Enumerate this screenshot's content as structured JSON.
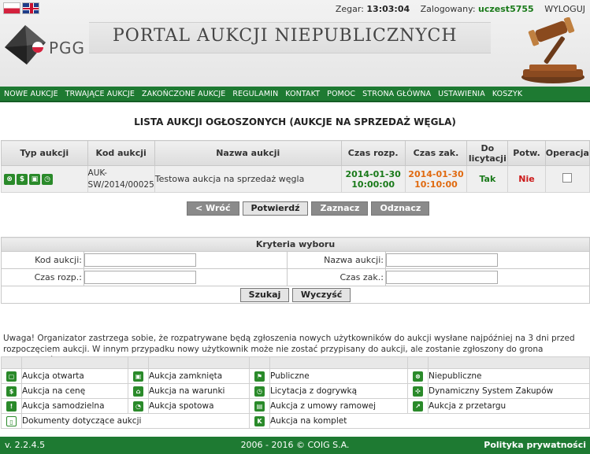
{
  "header": {
    "clock_label": "Zegar:",
    "clock_value": "13:03:04",
    "logged_label": "Zalogowany:",
    "logged_user": "uczest5755",
    "logout": "WYLOGUJ",
    "logo_text": "PGG",
    "banner_title": "PORTAL AUKCJI NIEPUBLICZNYCH"
  },
  "nav": [
    "NOWE AUKCJE",
    "TRWAJĄCE AUKCJE",
    "ZAKOŃCZONE AUKCJE",
    "REGULAMIN",
    "KONTAKT",
    "POMOC",
    "STRONA GŁÓWNA",
    "USTAWIENIA",
    "KOSZYK"
  ],
  "page_title": "LISTA AUKCJI OGŁOSZONYCH (AUKCJE NA SPRZEDAŻ WĘGLA)",
  "table": {
    "headers": [
      "Typ aukcji",
      "Kod aukcji",
      "Nazwa aukcji",
      "Czas rozp.",
      "Czas zak.",
      "Do licytacji",
      "Potw.",
      "Operacja"
    ],
    "row": {
      "code": "AUK-SW/2014/00025",
      "name": "Testowa aukcja na sprzedaż węgla",
      "start_date": "2014-01-30",
      "start_time": "10:00:00",
      "end_date": "2014-01-30",
      "end_time": "10:10:00",
      "do_licytacji": "Tak",
      "potw": "Nie"
    }
  },
  "buttons": {
    "back": "< Wróć",
    "confirm": "Potwierdź",
    "select": "Zaznacz",
    "deselect": "Odznacz"
  },
  "criteria": {
    "title": "Kryteria wyboru",
    "code_label": "Kod aukcji:",
    "name_label": "Nazwa aukcji:",
    "start_label": "Czas rozp.:",
    "end_label": "Czas zak.:",
    "search": "Szukaj",
    "clear": "Wyczyść"
  },
  "note": "Uwaga! Organizator zastrzega sobie, że rozpatrywane będą zgłoszenia nowych użytkowników do aukcji wysłane najpóźniej na 3 dni przed rozpoczęciem aukcji. W innym przypadku nowy użytkownik może nie zostać przypisany do aukcji, ale zostanie zgłoszony do grona kontrahentów.",
  "legend": [
    [
      "Aukcja otwarta",
      "Aukcja zamknięta",
      "Publiczne",
      "Niepubliczne"
    ],
    [
      "Aukcja na cenę",
      "Aukcja na warunki",
      "Licytacja z dogrywką",
      "Dynamiczny System Zakupów"
    ],
    [
      "Aukcja samodzielna",
      "Aukcja spotowa",
      "Aukcja z umowy ramowej",
      "Aukcja z przetargu"
    ],
    [
      "Dokumenty dotyczące aukcji",
      "Aukcja na komplet"
    ]
  ],
  "footer": {
    "version": "v. 2.2.4.5",
    "copyright": "2006 - 2016 © COIG S.A.",
    "privacy": "Polityka prywatności"
  },
  "colors": {
    "brand_green": "#1e7a32",
    "start_date": "#1a7a1a",
    "end_date": "#e06a10",
    "nie": "#cc1a1a"
  }
}
